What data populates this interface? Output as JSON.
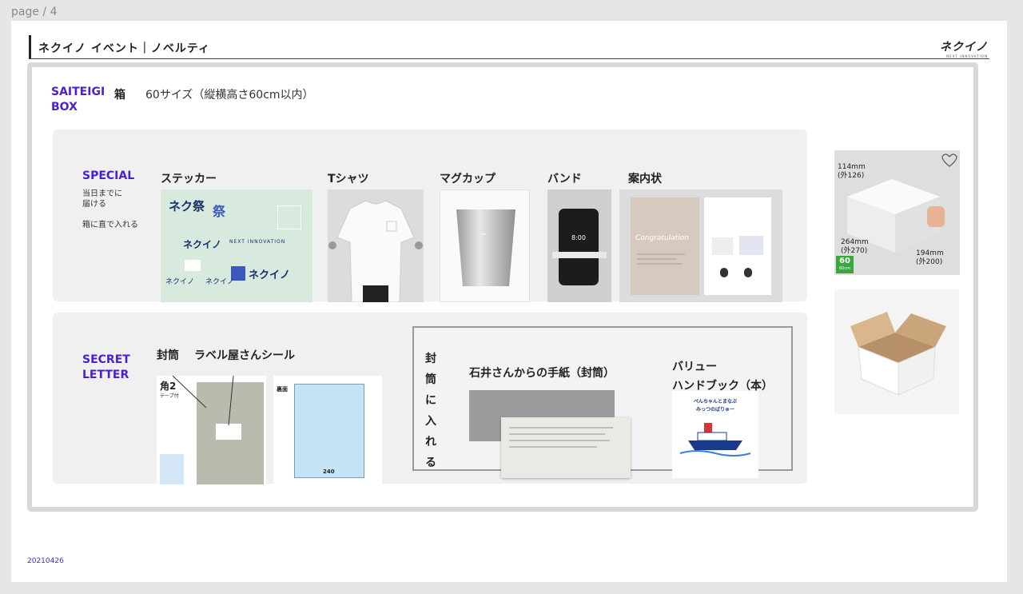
{
  "page_label": "page / 4",
  "header": {
    "title": "ネクイノ イベント｜ノベルティ",
    "logo": "ネクイノ",
    "logo_sub": "NEXT INNOVATION"
  },
  "box": {
    "label_line1": "SAITEIGI",
    "label_line2": "BOX",
    "hako": "箱",
    "size": "60サイズ（縦横高さ60cm以内）"
  },
  "special": {
    "title": "SPECIAL",
    "note1_line1": "当日までに",
    "note1_line2": "届ける",
    "note2": "箱に直で入れる",
    "items": [
      "ステッカー",
      "Tシャツ",
      "マグカップ",
      "バンド",
      "案内状"
    ],
    "sticker_texts": [
      "ネク祭",
      "ネクイノ",
      "NEXT INNOVATION",
      "祭"
    ],
    "phone_time": "8:00",
    "card_script": "Congratulation"
  },
  "secret": {
    "title_line1": "SECRET",
    "title_line2": "LETTER",
    "envelope_label": "封筒",
    "seal_label": "ラベル屋さんシール",
    "kaku2": "角2",
    "tape": "テープ付",
    "back": "裏面",
    "width240": "240",
    "vertical": [
      "封",
      "筒",
      "に",
      "入",
      "れ",
      "る"
    ],
    "letter_title": "石井さんからの手紙（封筒）",
    "value_line1": "バリュー",
    "value_line2": "ハンドブック（本）",
    "book_title_line1": "ぺんちゃんとまなぶ",
    "book_title_line2": "みっつのばりゅー"
  },
  "box_photo": {
    "d1_line1": "114mm",
    "d1_line2": "(外126)",
    "d2_line1": "264mm",
    "d2_line2": "(外270)",
    "d3_line1": "194mm",
    "d3_line2": "(外200)",
    "badge": "60",
    "badge_sub": "60cm"
  },
  "footer": {
    "date": "20210426"
  },
  "colors": {
    "accent": "#4a1fd1",
    "panel": "#f0f0f0",
    "frame": "#d8d8d8",
    "badge": "#3aa640"
  }
}
